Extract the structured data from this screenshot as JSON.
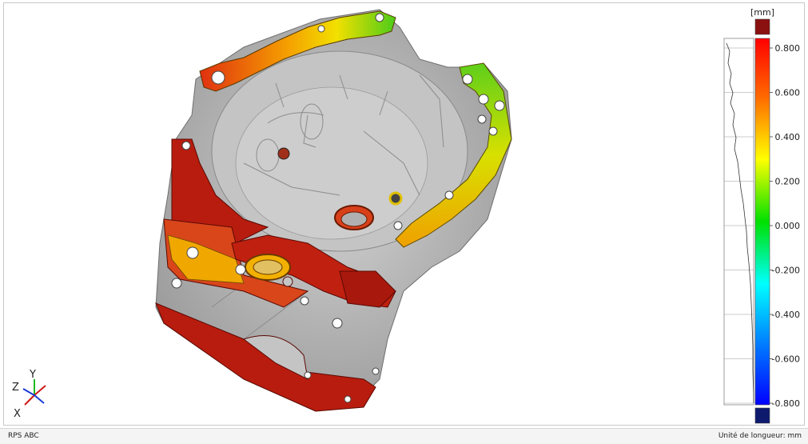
{
  "viewer": {
    "status_left": "RPS ABC",
    "status_right": "Unité de longueur: mm"
  },
  "legend": {
    "unit": "[mm]",
    "ticks": [
      {
        "label": "0.800",
        "value": 0.8
      },
      {
        "label": "0.600",
        "value": 0.6
      },
      {
        "label": "0.400",
        "value": 0.4
      },
      {
        "label": "0.200",
        "value": 0.2
      },
      {
        "label": "0.000",
        "value": 0.0
      },
      {
        "label": "-0.200",
        "value": -0.2
      },
      {
        "label": "-0.400",
        "value": -0.4
      },
      {
        "label": "-0.600",
        "value": -0.6
      },
      {
        "label": "-0.800",
        "value": -0.8
      }
    ],
    "range": [
      -0.8,
      0.8
    ],
    "over_color": "#8b1010",
    "under_color": "#0d1a6e",
    "gradient_colors": [
      "#ff0000",
      "#ff8c00",
      "#ffff00",
      "#00e000",
      "#00ffff",
      "#0080ff",
      "#0000ff"
    ]
  },
  "axes_triad": {
    "x_label": "X",
    "y_label": "Y",
    "z_label": "Z"
  },
  "model": {
    "base_color": "#b4b4b4",
    "deviation_colors": [
      "#b81c0e",
      "#e83a10",
      "#f5a000",
      "#f2e000",
      "#4ccc1a"
    ]
  }
}
